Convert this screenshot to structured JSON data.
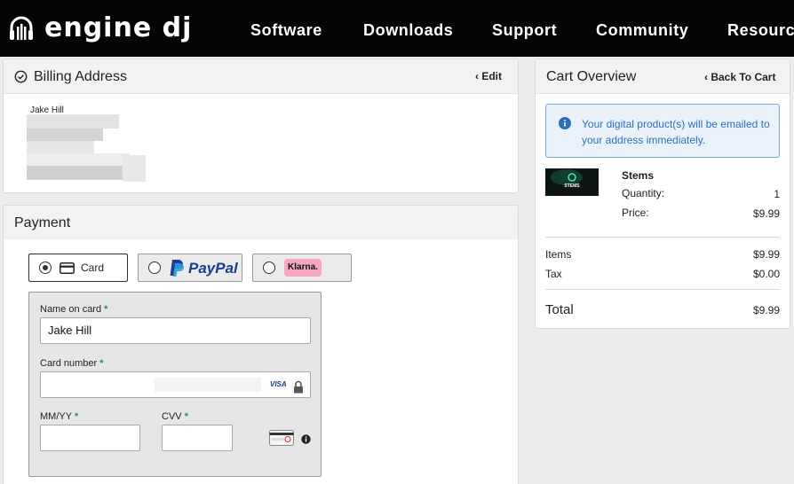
{
  "brand": {
    "logo_text": "engine dj"
  },
  "nav": {
    "items": [
      "Software",
      "Downloads",
      "Support",
      "Community",
      "Resources"
    ]
  },
  "billing": {
    "title": "Billing Address",
    "edit_label": "Edit",
    "name": "Jake Hill"
  },
  "payment": {
    "title": "Payment",
    "methods": {
      "card": "Card",
      "paypal": "PayPal",
      "klarna": "Klarna."
    },
    "selected": "Card",
    "fields": {
      "name_label": "Name on card",
      "name_value": "Jake Hill",
      "number_label": "Card number",
      "number_brand": "VISA",
      "expiry_label": "MM/YY",
      "cvv_label": "CVV",
      "required_mark": "*"
    }
  },
  "cart": {
    "title": "Cart Overview",
    "back_label": "Back To Cart",
    "notice": "Your digital product(s) will be emailed to your address immediately.",
    "product": {
      "name": "Stems",
      "thumb_text": "STEMS",
      "quantity_label": "Quantity:",
      "quantity": "1",
      "price_label": "Price:",
      "price": "$9.99"
    },
    "summary": {
      "items_label": "Items",
      "items_value": "$9.99",
      "tax_label": "Tax",
      "tax_value": "$0.00",
      "total_label": "Total",
      "total_value": "$9.99"
    }
  },
  "colors": {
    "header_bg": "#050505",
    "required": "#2a8a62",
    "info_bg": "#e9f2fb",
    "info_accent": "#2f6fba",
    "paypal_dark": "#1b3d8f",
    "paypal_light": "#2d9be0",
    "klarna_pink": "#f6a7bf"
  }
}
